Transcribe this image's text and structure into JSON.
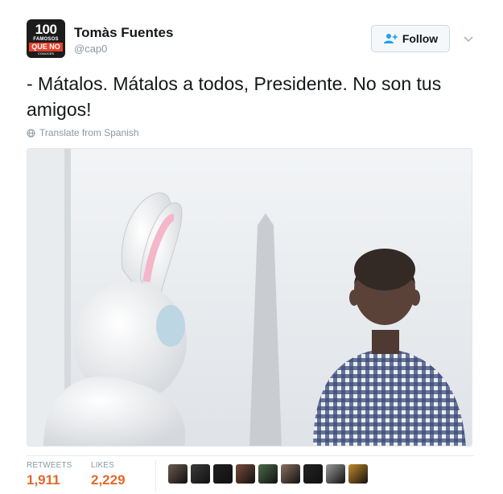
{
  "author": {
    "name": "Tomàs Fuentes",
    "handle": "@cap0",
    "avatar_text": {
      "line1": "100",
      "line2": "FAMOSOS",
      "line3": "QUE NO",
      "line4": "CONOCES"
    }
  },
  "header": {
    "follow_label": "Follow",
    "follow_icon": "add-user-icon",
    "menu_icon": "chevron-down-icon"
  },
  "tweet": {
    "text": "- Mátalos. Mátalos a todos, Presidente. No son tus amigos!",
    "translate_label": "Translate from Spanish",
    "translate_icon": "globe-icon"
  },
  "photo": {
    "subject": "photo-easter-bunny-and-man-facing-monument"
  },
  "stats": {
    "retweets_label": "RETWEETS",
    "retweets_value": "1,911",
    "likes_label": "LIKES",
    "likes_value": "2,229"
  },
  "likers": [
    {
      "color": "#6b5a4e"
    },
    {
      "color": "#3a3a3a"
    },
    {
      "color": "#1f1f1f"
    },
    {
      "color": "#7a4b3a"
    },
    {
      "color": "#4e6a4a"
    },
    {
      "color": "#8a7060"
    },
    {
      "color": "#222222"
    },
    {
      "color": "#9a9a9a"
    },
    {
      "color": "#c48a2a"
    }
  ],
  "colors": {
    "accent": "#e2692c",
    "muted": "#8899a6",
    "text": "#14171a"
  }
}
